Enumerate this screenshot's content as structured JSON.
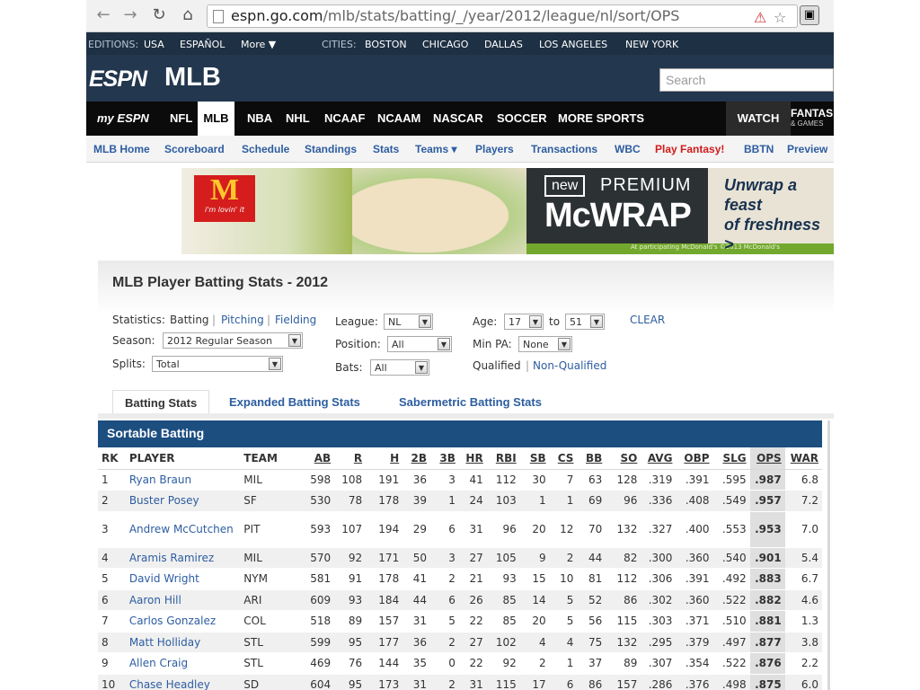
{
  "browser": {
    "url_host": "espn.go.com",
    "url_path": "/mlb/stats/batting/_/year/2012/league/nl/sort/OPS",
    "back_icon": "back-arrow-icon",
    "forward_icon": "forward-arrow-icon",
    "reload_icon": "reload-icon",
    "home_icon": "home-icon"
  },
  "editions_bar": {
    "editions_label": "EDITIONS:",
    "usa": "USA",
    "espanol": "ESPAÑOL",
    "more": "More ▼",
    "cities_label": "CITIES:",
    "cities": [
      "BOSTON",
      "CHICAGO",
      "DALLAS",
      "LOS ANGELES",
      "NEW YORK"
    ]
  },
  "header": {
    "logo": "ESPN",
    "title": "MLB",
    "search_placeholder": "Search"
  },
  "sport_nav": {
    "myespn": "my ESPN",
    "items": [
      "NFL",
      "MLB",
      "NBA",
      "NHL",
      "NCAAF",
      "NCAAM",
      "NASCAR",
      "SOCCER",
      "MORE SPORTS"
    ],
    "watch": "WATCH",
    "fantasy": "FANTAS",
    "fantasy_sub": "& GAMES"
  },
  "sub_nav": [
    "MLB Home",
    "Scoreboard",
    "Schedule",
    "Standings",
    "Stats",
    "Teams ▾",
    "Players",
    "Transactions",
    "WBC",
    "Play Fantasy!",
    "BBTN",
    "Preview"
  ],
  "ad": {
    "brand_slogan": "i'm lovin' it",
    "new_label": "new",
    "premium": "PREMIUM",
    "product": "McWRAP",
    "tagline_1": "Unwrap a feast",
    "tagline_2": "of freshness >",
    "fineprint": "At participating McDonald's ©2013 McDonald's"
  },
  "page_title": "MLB Player Batting Stats - 2012",
  "filters": {
    "statistics_label": "Statistics:",
    "stat_batting": "Batting",
    "sep": "|",
    "stat_pitching": "Pitching",
    "stat_fielding": "Fielding",
    "season_label": "Season:",
    "season_value": "2012 Regular Season",
    "splits_label": "Splits:",
    "splits_value": "Total",
    "league_label": "League:",
    "league_value": "NL",
    "position_label": "Position:",
    "position_value": "All",
    "bats_label": "Bats:",
    "bats_value": "All",
    "age_label": "Age:",
    "age_from": "17",
    "age_to_label": "to",
    "age_to": "51",
    "minpa_label": "Min PA:",
    "minpa_value": "None",
    "qualified": "Qualified",
    "non_qualified": "Non-Qualified",
    "clear": "CLEAR"
  },
  "tabs": [
    "Batting Stats",
    "Expanded Batting Stats",
    "Sabermetric Batting Stats"
  ],
  "table": {
    "caption": "Sortable Batting",
    "columns": [
      "RK",
      "PLAYER",
      "TEAM",
      "AB",
      "R",
      "H",
      "2B",
      "3B",
      "HR",
      "RBI",
      "SB",
      "CS",
      "BB",
      "SO",
      "AVG",
      "OBP",
      "SLG",
      "OPS",
      "WAR"
    ],
    "rows": [
      [
        "1",
        "Ryan Braun",
        "MIL",
        "598",
        "108",
        "191",
        "36",
        "3",
        "41",
        "112",
        "30",
        "7",
        "63",
        "128",
        ".319",
        ".391",
        ".595",
        ".987",
        "6.8"
      ],
      [
        "2",
        "Buster Posey",
        "SF",
        "530",
        "78",
        "178",
        "39",
        "1",
        "24",
        "103",
        "1",
        "1",
        "69",
        "96",
        ".336",
        ".408",
        ".549",
        ".957",
        "7.2"
      ],
      [
        "3",
        "Andrew McCutchen",
        "PIT",
        "593",
        "107",
        "194",
        "29",
        "6",
        "31",
        "96",
        "20",
        "12",
        "70",
        "132",
        ".327",
        ".400",
        ".553",
        ".953",
        "7.0"
      ],
      [
        "4",
        "Aramis Ramirez",
        "MIL",
        "570",
        "92",
        "171",
        "50",
        "3",
        "27",
        "105",
        "9",
        "2",
        "44",
        "82",
        ".300",
        ".360",
        ".540",
        ".901",
        "5.4"
      ],
      [
        "5",
        "David Wright",
        "NYM",
        "581",
        "91",
        "178",
        "41",
        "2",
        "21",
        "93",
        "15",
        "10",
        "81",
        "112",
        ".306",
        ".391",
        ".492",
        ".883",
        "6.7"
      ],
      [
        "6",
        "Aaron Hill",
        "ARI",
        "609",
        "93",
        "184",
        "44",
        "6",
        "26",
        "85",
        "14",
        "5",
        "52",
        "86",
        ".302",
        ".360",
        ".522",
        ".882",
        "4.6"
      ],
      [
        "7",
        "Carlos Gonzalez",
        "COL",
        "518",
        "89",
        "157",
        "31",
        "5",
        "22",
        "85",
        "20",
        "5",
        "56",
        "115",
        ".303",
        ".371",
        ".510",
        ".881",
        "1.3"
      ],
      [
        "8",
        "Matt Holliday",
        "STL",
        "599",
        "95",
        "177",
        "36",
        "2",
        "27",
        "102",
        "4",
        "4",
        "75",
        "132",
        ".295",
        ".379",
        ".497",
        ".877",
        "3.8"
      ],
      [
        "9",
        "Allen Craig",
        "STL",
        "469",
        "76",
        "144",
        "35",
        "0",
        "22",
        "92",
        "2",
        "1",
        "37",
        "89",
        ".307",
        ".354",
        ".522",
        ".876",
        "2.2"
      ],
      [
        "10",
        "Chase Headley",
        "SD",
        "604",
        "95",
        "173",
        "31",
        "2",
        "31",
        "115",
        "17",
        "6",
        "86",
        "157",
        ".286",
        ".376",
        ".498",
        ".875",
        "6.0"
      ]
    ]
  }
}
